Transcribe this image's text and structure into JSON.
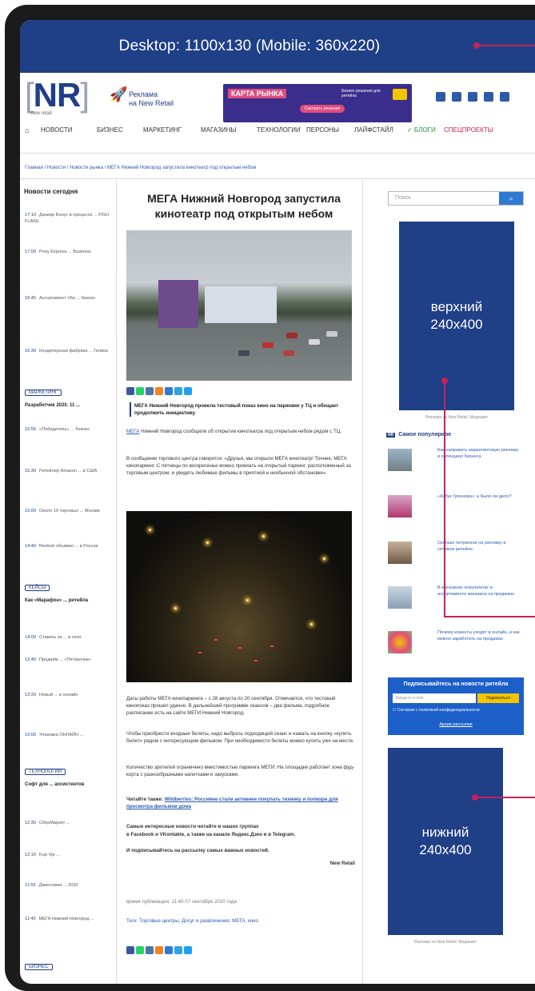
{
  "banner": {
    "text": "Desktop: 1100x130 (Mobile: 360x220)"
  },
  "header": {
    "logo": "NR",
    "logo_sub": "new retail",
    "ad_small": "Реклама\nна New Retail",
    "ad_big_title": "КАРТА РЫНКА",
    "ad_big_text": "Бизнес-решения для ретейла",
    "ad_big_button": "Смотреть решения"
  },
  "nav": {
    "items": [
      "НОВОСТИ",
      "БИЗНЕС",
      "МАРКЕТИНГ",
      "МАГАЗИНЫ",
      "ТЕХНОЛОГИИ",
      "ПЕРСОНЫ",
      "ЛАЙФСТАЙЛ",
      "✓ БЛОГИ",
      "СПЕЦПРОЕКТЫ"
    ]
  },
  "breadcrumb": "Главная / Новости / Новости рынка / МЕГА Нижний Новгород запустила кинотеатр под открытым небом",
  "left": {
    "heading": "Новости сегодня",
    "items": [
      {
        "time": "17:10",
        "text": "Данияр Бонус в процессе ... FISH FLAKE"
      },
      {
        "time": "17:00",
        "text": "Pony Express ... Business"
      },
      {
        "time": "16:45",
        "text": "Ассортимент Vita ... бизнес"
      },
      {
        "time": "16:30",
        "text": "Кондитерская фабрика ... Гелика"
      }
    ],
    "tag1": "МАРКЕТИНГ",
    "bold1": "Разработчик 2020. 11 ...",
    "items2": [
      {
        "time": "15:55",
        "text": "«Победитель» ... бизнес"
      },
      {
        "time": "15:30",
        "text": "Ритейлер Amazon ... в США"
      },
      {
        "time": "15:00",
        "text": "Около 10 торговых ... Москве"
      },
      {
        "time": "14:40",
        "text": "Reebok объявил ... в России"
      }
    ],
    "tag2": "КЕЙСЫ",
    "bold2": "Как «Марафон» ... ритейла",
    "items3": [
      {
        "time": "14:00",
        "text": "Ставить за ... в сети"
      },
      {
        "time": "13:40",
        "text": "Продаём ... «Пятёрочки»"
      },
      {
        "time": "13:20",
        "text": "Новый ... в онлайн"
      },
      {
        "time": "13:00",
        "text": "Упаковка ОНЛАЙН ..."
      }
    ],
    "tag3": "ТЕХНОЛОГИИ",
    "bold3": "Софт для ... ассистентов",
    "items4": [
      {
        "time": "12:30",
        "text": "СберМаркет ..."
      },
      {
        "time": "12:10",
        "text": "Kup Vip ..."
      },
      {
        "time": "11:55",
        "text": "Джинсовая ... 2020"
      },
      {
        "time": "11:40",
        "text": "МЕГА Нижний Новгород ..."
      }
    ],
    "tag4": "БИЗНЕС"
  },
  "article": {
    "title": "МЕГА Нижний Новгород запустила кинотеатр под открытым небом",
    "lead": "МЕГА Нижний Новгород провела тестовый показ кино на парковке у ТЦ и обещает продолжить инициативу.",
    "p1_link": "МЕГА",
    "p1": "Нижний Новгород сообщили об открытии кинотеатра под открытым небом рядом с ТЦ.",
    "p2": "В сообщении торгового центра говорится: «Друзья, мы открыли МЕГА кинотеатр! Точнее, МЕГА кинопаркинг. С пятницы по воскресенье можно приехать на открытый паркинг, расположенный за торговым центром, и увидеть любимые фильмы в приятной и необычной обстановке».",
    "p3": "Даты работы МЕГА кинопаркинга – с 28 августа по 20 сентября. Отмечается, что тестовый кинопоказ прошел удачно. В дальнейшей программе сеансов – два фильма, подробное расписание есть на сайте МЕГИ Нижний Новгород.",
    "p4": "Чтобы приобрести входные билеты, надо выбрать подходящий сеанс и нажать на кнопку «купить билет» рядом с интересующим фильмом. При необходимости билеты можно купить уже на месте.",
    "p5": "Количество зрителей ограничено вместимостью паркинга МЕГИ. На площадке работает зона фуд-корта с разнообразными напитками и закусками.",
    "also_label": "Читайте также:",
    "also_link": "Wildberries: Россияне стали активнее покупать технику и попкорн для просмотра фильмов дома",
    "more": "Самые интересные новости читайте в наших группах",
    "more2": "в Facebook и VKontakte, а также на канале Яндекс.Дзен и в Telegram.",
    "sub_line": "И подписывайтесь на рассылку самых важных новостей.",
    "author": "New Retail",
    "pub": "время публикации: 11:40 07 сентября 2020 года",
    "tags": "Теги: Торговые центры, Досуг и развлечения, МЕГА, кино"
  },
  "right": {
    "search_placeholder": "Поиск",
    "ad_top": [
      "верхний",
      "240x400"
    ],
    "ad_caption": "Реклама на New Retail. Медиакит",
    "popular_title": "Самое популярное",
    "popular": [
      "Как направить маркетинговую рекламу и потенциал бизнеса",
      "«Азбук Грязнова»: а было ли дело?",
      "Сколько потратили на рекламу в сетевом ритейле",
      "В магазинах покупатели: в ассортименте магазина на продажах",
      "Почему клиенты уходят в онлайн, и как можно заработать на продажах"
    ],
    "subscribe_title": "Подписывайтесь на новости ритейла",
    "subscribe_placeholder": "Введите e-mail",
    "subscribe_button": "Подписаться",
    "subscribe_check": "Согласие с политикой конфиденциальности",
    "subscribe_archive": "Архив рассылки",
    "ad_bottom": [
      "нижний",
      "240x400"
    ],
    "ad_caption2": "Реклама на New Retail. Медиакит"
  },
  "colors": {
    "brand": "#1f3f86",
    "pointer": "#c4235a"
  }
}
